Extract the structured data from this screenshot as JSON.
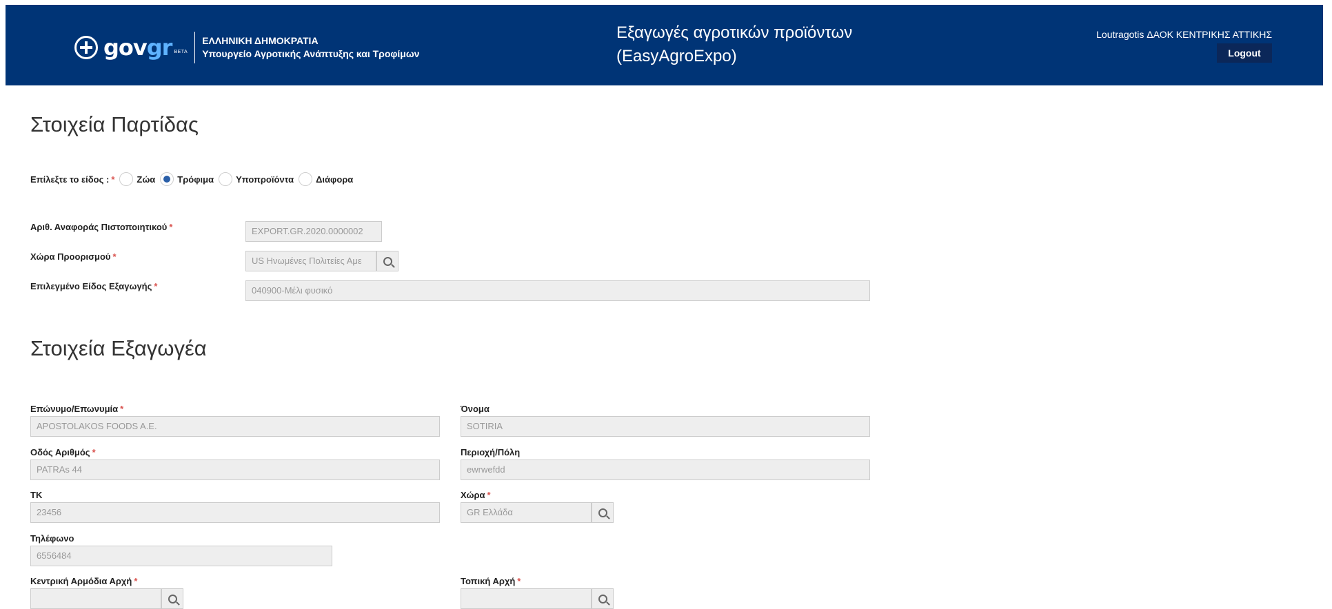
{
  "header": {
    "logo_text_1": "gov",
    "logo_text_2": "gr",
    "beta": "BETA",
    "ministry_line1": "ΕΛΛΗΝΙΚΗ ΔΗΜΟΚΡΑΤΙΑ",
    "ministry_line2": "Υπουργείο Αγροτικής Ανάπτυξης και Τροφίμων",
    "app_title_line1": "Εξαγωγές αγροτικών προϊόντων",
    "app_title_line2": "(EasyAgroExpo)",
    "user": "Loutragotis ΔΑΟΚ ΚΕΝΤΡΙΚΗΣ ΑΤΤΙΚΗΣ",
    "logout": "Logout"
  },
  "batch": {
    "title": "Στοιχεία Παρτίδας",
    "type_label": "Επίλεξτε το είδος :",
    "options": [
      "Ζώα",
      "Τρόφιμα",
      "Υποπροϊόντα",
      "Διάφορα"
    ],
    "selected": "Τρόφιμα",
    "cert_label": "Αριθ. Αναφοράς Πιστοποιητικού",
    "cert_value": "EXPORT.GR.2020.0000002",
    "dest_label": "Χώρα Προορισμού",
    "dest_value": "US Ηνωμένες Πολιτείες Αμε",
    "export_type_label": "Επιλεγμένο Είδος Εξαγωγής",
    "export_type_value": "040900-Μέλι φυσικό"
  },
  "exporter": {
    "title": "Στοιχεία Εξαγωγέα",
    "surname_label": "Επώνυμο/Επωνυμία",
    "surname_value": "APOSTOLAKOS FOODS A.E.",
    "name_label": "Όνομα",
    "name_value": "SOTIRIA",
    "street_label": "Οδός Αριθμός",
    "street_value": "PATRAs 44",
    "city_label": "Περιοχή/Πόλη",
    "city_value": "ewrwefdd",
    "zip_label": "ΤΚ",
    "zip_value": "23456",
    "country_label": "Χώρα",
    "country_value": "GR Ελλάδα",
    "phone_label": "Τηλέφωνο",
    "phone_value": "6556484",
    "central_authority_label": "Κεντρική Αρμόδια Αρχή",
    "local_authority_label": "Τοπική Αρχή"
  }
}
